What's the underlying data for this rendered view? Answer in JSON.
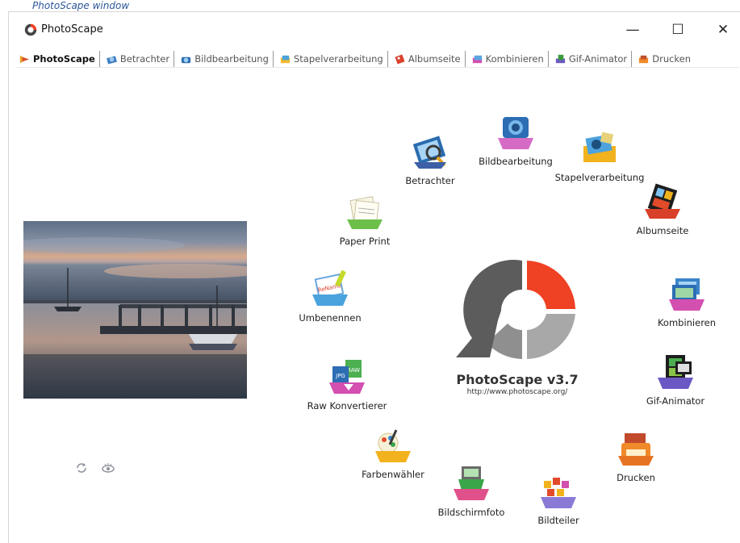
{
  "heading": "PhotoScape window",
  "window": {
    "title": "PhotoScape",
    "controls": {
      "minimize": "—",
      "maximize": "☐",
      "close": "✕"
    }
  },
  "tabs": [
    {
      "label": "PhotoScape",
      "active": true
    },
    {
      "label": "Betrachter"
    },
    {
      "label": "Bildbearbeitung"
    },
    {
      "label": "Stapelverarbeitung"
    },
    {
      "label": "Albumseite"
    },
    {
      "label": "Kombinieren"
    },
    {
      "label": "Gif-Animator"
    },
    {
      "label": "Drucken"
    }
  ],
  "features": [
    {
      "label": "Betrachter",
      "icon": "viewer-icon"
    },
    {
      "label": "Bildbearbeitung",
      "icon": "editor-icon"
    },
    {
      "label": "Stapelverarbeitung",
      "icon": "batch-icon"
    },
    {
      "label": "Albumseite",
      "icon": "page-icon"
    },
    {
      "label": "Kombinieren",
      "icon": "combine-icon"
    },
    {
      "label": "Gif-Animator",
      "icon": "gif-icon"
    },
    {
      "label": "Drucken",
      "icon": "print-icon"
    },
    {
      "label": "Bildteiler",
      "icon": "splitter-icon"
    },
    {
      "label": "Bildschirmfoto",
      "icon": "screenshot-icon"
    },
    {
      "label": "Farbenwähler",
      "icon": "color-picker-icon"
    },
    {
      "label": "Raw Konvertierer",
      "icon": "raw-converter-icon"
    },
    {
      "label": "Umbenennen",
      "icon": "rename-icon"
    },
    {
      "label": "Paper Print",
      "icon": "paper-print-icon"
    }
  ],
  "brand": {
    "name": "PhotoScape v3.7",
    "url": "http://www.photoscape.org/",
    "colors": {
      "red": "#ef4123",
      "gray_dark": "#555555",
      "gray_mid": "#7f7f7f",
      "gray_light": "#a8a8a8"
    }
  },
  "icons": {
    "rename_badge": "ReName",
    "raw_badge": "RAW",
    "jpg_badge": "JPG"
  }
}
